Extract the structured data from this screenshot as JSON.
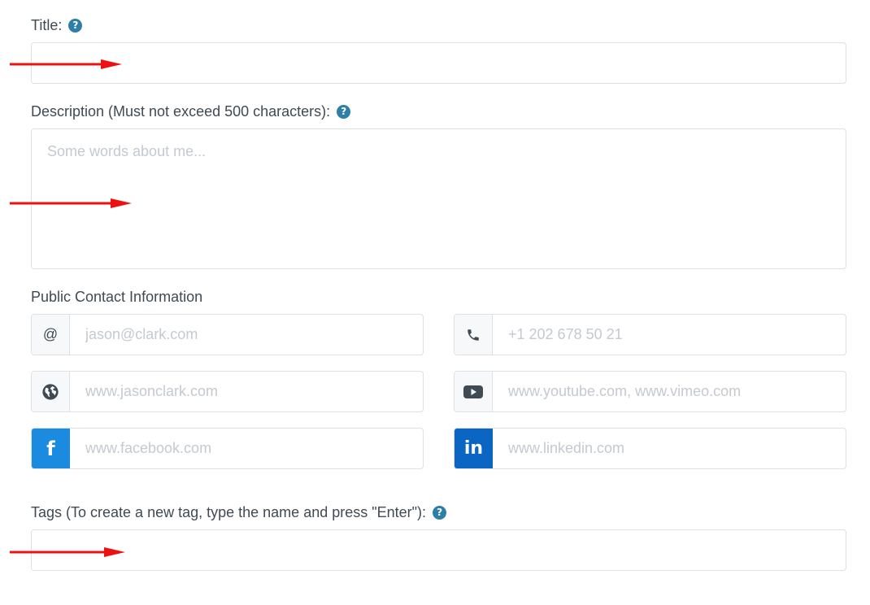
{
  "title": {
    "label": "Title:",
    "help": "?",
    "value": "",
    "placeholder": ""
  },
  "description": {
    "label": "Description (Must not exceed 500 characters):",
    "help": "?",
    "value": "",
    "placeholder": "Some words about me..."
  },
  "contact": {
    "heading": "Public Contact Information",
    "email": {
      "icon": "at-icon",
      "symbol": "@",
      "placeholder": "jason@clark.com"
    },
    "phone": {
      "icon": "phone-icon",
      "placeholder": "+1 202 678 50 21"
    },
    "website": {
      "icon": "globe-icon",
      "placeholder": "www.jasonclark.com"
    },
    "video": {
      "icon": "youtube-icon",
      "placeholder": "www.youtube.com, www.vimeo.com"
    },
    "facebook": {
      "icon": "facebook-icon",
      "symbol": "f",
      "placeholder": "www.facebook.com",
      "color": "#1b8be0"
    },
    "linkedin": {
      "icon": "linkedin-icon",
      "symbol": "in",
      "placeholder": "www.linkedin.com",
      "color": "#0a66c2"
    }
  },
  "tags": {
    "label": "Tags (To create a new tag, type the name and press \"Enter\"):",
    "help": "?",
    "value": ""
  },
  "colors": {
    "accent": "#2e7fa8",
    "annotation_arrow": "#ee1111",
    "border": "#dee2e6"
  }
}
